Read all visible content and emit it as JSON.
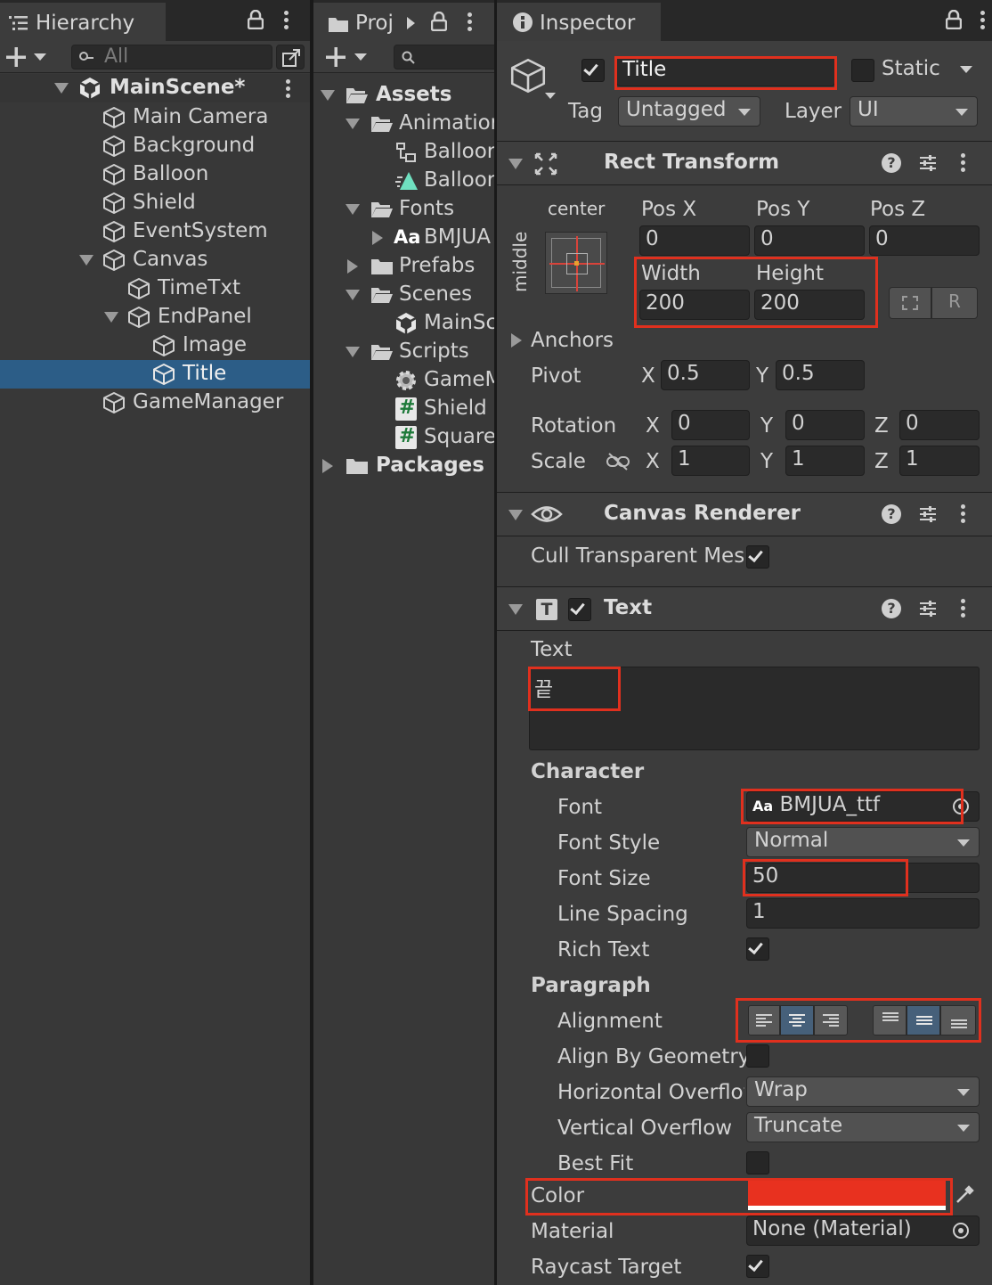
{
  "hierarchy": {
    "tab": "Hierarchy",
    "search_placeholder": "All",
    "scene": "MainScene*",
    "items": [
      {
        "label": "Main Camera"
      },
      {
        "label": "Background"
      },
      {
        "label": "Balloon"
      },
      {
        "label": "Shield"
      },
      {
        "label": "EventSystem"
      },
      {
        "label": "Canvas"
      },
      {
        "label": "TimeTxt"
      },
      {
        "label": "EndPanel"
      },
      {
        "label": "Image"
      },
      {
        "label": "Title"
      },
      {
        "label": "GameManager"
      }
    ]
  },
  "project": {
    "tab": "Proj",
    "items": [
      {
        "label": "Assets"
      },
      {
        "label": "Animatior"
      },
      {
        "label": "Balloor"
      },
      {
        "label": "Balloor"
      },
      {
        "label": "Fonts"
      },
      {
        "label": "BMJUA"
      },
      {
        "label": "Prefabs"
      },
      {
        "label": "Scenes"
      },
      {
        "label": "MainSc"
      },
      {
        "label": "Scripts"
      },
      {
        "label": "GameM"
      },
      {
        "label": "Shield"
      },
      {
        "label": "Square"
      },
      {
        "label": "Packages"
      }
    ],
    "font_icon_text": "Aa",
    "script_icon_text": "#"
  },
  "inspector": {
    "tab": "Inspector",
    "name": "Title",
    "static_label": "Static",
    "tag_label": "Tag",
    "tag_value": "Untagged",
    "layer_label": "Layer",
    "layer_value": "UI",
    "rect": {
      "title": "Rect Transform",
      "anchor_h": "center",
      "anchor_v": "middle",
      "posx_label": "Pos X",
      "posy_label": "Pos Y",
      "posz_label": "Pos Z",
      "posx": "0",
      "posy": "0",
      "posz": "0",
      "width_label": "Width",
      "height_label": "Height",
      "width": "200",
      "height": "200",
      "r_label": "R",
      "anchors_label": "Anchors",
      "pivot_label": "Pivot",
      "pivot_x": "0.5",
      "pivot_y": "0.5",
      "rotation_label": "Rotation",
      "rot_x": "0",
      "rot_y": "0",
      "rot_z": "0",
      "scale_label": "Scale",
      "scale_x": "1",
      "scale_y": "1",
      "scale_z": "1",
      "x": "X",
      "y": "Y",
      "z": "Z"
    },
    "canvas_renderer": {
      "title": "Canvas Renderer",
      "cull_label": "Cull Transparent Mes"
    },
    "text": {
      "title": "Text",
      "text_label": "Text",
      "text_value": "끝",
      "character_label": "Character",
      "font_label": "Font",
      "font_icon": "Aa",
      "font_value": "BMJUA_ttf",
      "font_style_label": "Font Style",
      "font_style_value": "Normal",
      "font_size_label": "Font Size",
      "font_size_value": "50",
      "line_spacing_label": "Line Spacing",
      "line_spacing_value": "1",
      "rich_text_label": "Rich Text",
      "paragraph_label": "Paragraph",
      "alignment_label": "Alignment",
      "align_geometry_label": "Align By Geometry",
      "h_overflow_label": "Horizontal Overflov",
      "h_overflow_value": "Wrap",
      "v_overflow_label": "Vertical Overflow",
      "v_overflow_value": "Truncate",
      "best_fit_label": "Best Fit",
      "color_label": "Color",
      "color_value": "#e8311f",
      "material_label": "Material",
      "material_value": "None (Material)",
      "raycast_label": "Raycast Target"
    }
  },
  "colors": {
    "highlight": "#e0301e",
    "selection": "#2c5d87"
  }
}
